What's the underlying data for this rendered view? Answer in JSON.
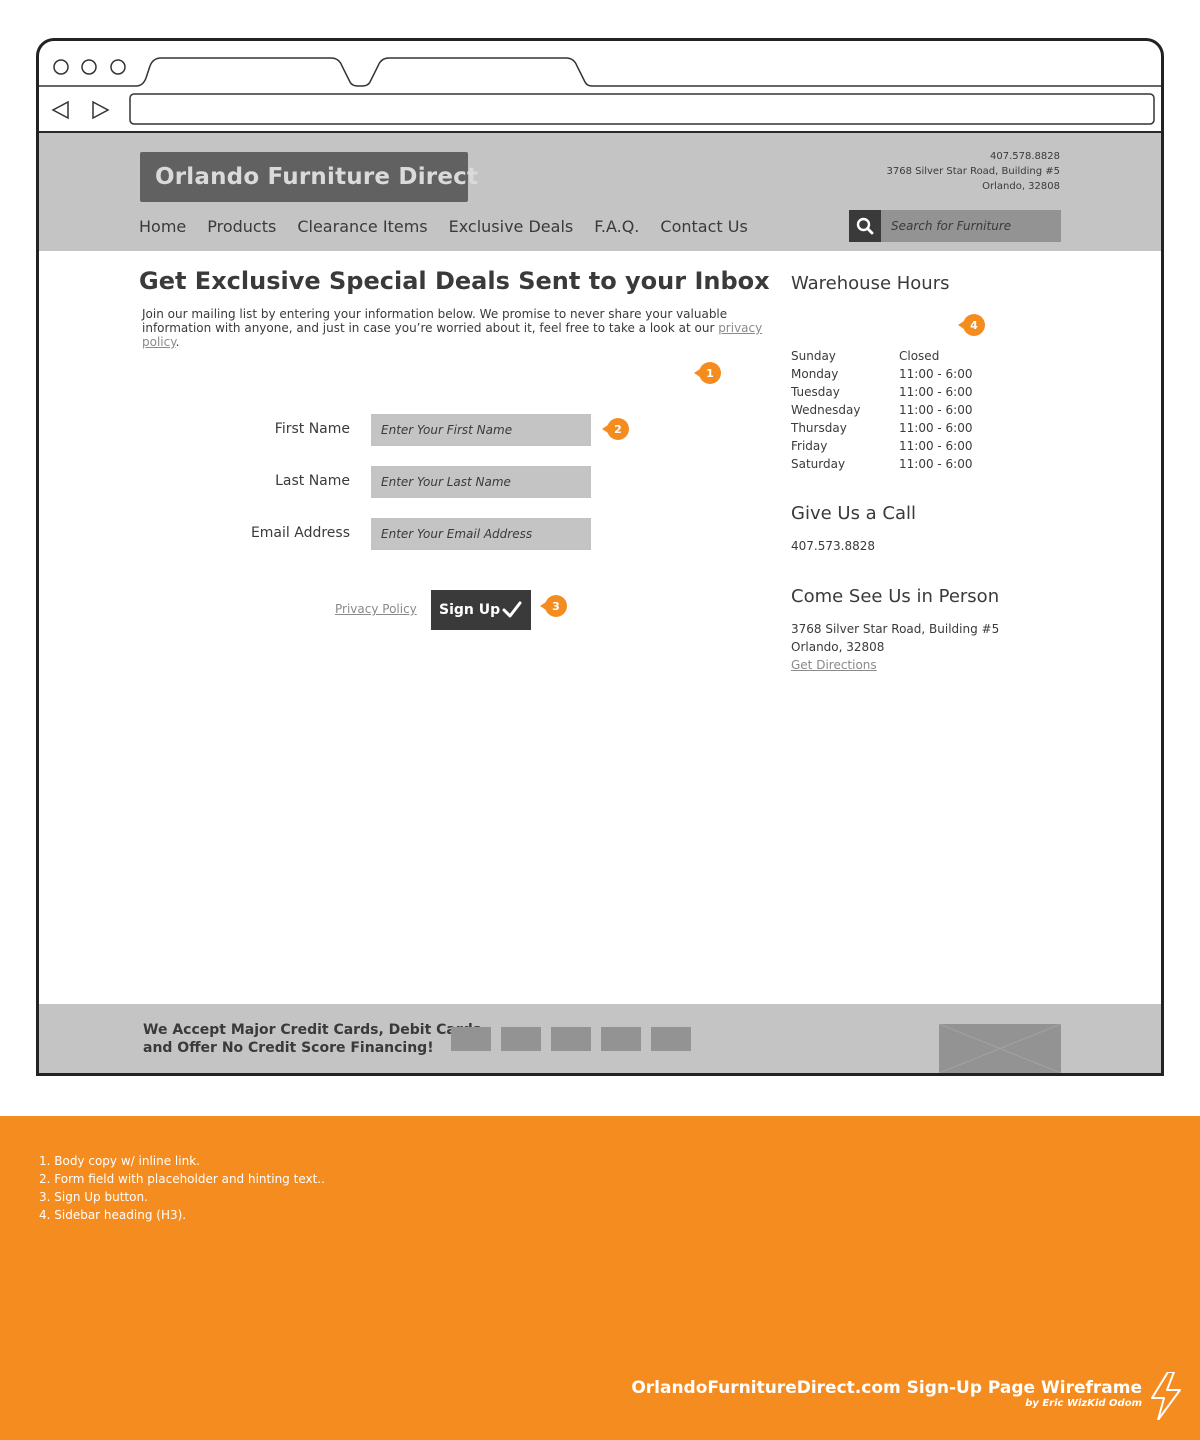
{
  "header": {
    "logo": "Orlando Furniture Direct",
    "phone": "407.578.8828",
    "address_line1": "3768 Silver Star Road, Building #5",
    "address_line2": "Orlando, 32808",
    "nav": [
      "Home",
      "Products",
      "Clearance Items",
      "Exclusive Deals",
      "F.A.Q.",
      "Contact Us"
    ],
    "search_placeholder": "Search for Furniture"
  },
  "main": {
    "title": "Get Exclusive Special Deals Sent to your Inbox",
    "intro_text": "Join our mailing list by entering your information below. We promise to never share your valuable information with anyone, and just in case you’re worried about it, feel free to take a look at our ",
    "intro_link": "privacy policy",
    "intro_end": ".",
    "form": {
      "first_name_label": "First Name",
      "first_name_placeholder": "Enter Your First Name",
      "last_name_label": "Last Name",
      "last_name_placeholder": "Enter Your Last Name",
      "email_label": "Email Address",
      "email_placeholder": "Enter Your Email Address",
      "privacy_link": "Privacy Policy",
      "signup_label": "Sign Up"
    }
  },
  "sidebar": {
    "hours_heading": "Warehouse Hours",
    "hours": [
      {
        "day": "Sunday",
        "time": "Closed"
      },
      {
        "day": "Monday",
        "time": "11:00 - 6:00"
      },
      {
        "day": "Tuesday",
        "time": "11:00 - 6:00"
      },
      {
        "day": "Wednesday",
        "time": "11:00 - 6:00"
      },
      {
        "day": "Thursday",
        "time": "11:00 - 6:00"
      },
      {
        "day": "Friday",
        "time": "11:00 - 6:00"
      },
      {
        "day": "Saturday",
        "time": "11:00 - 6:00"
      }
    ],
    "call_heading": "Give Us a Call",
    "call_phone": "407.573.8828",
    "visit_heading": "Come See Us in Person",
    "visit_line1": "3768 Silver Star Road, Building #5",
    "visit_line2": "Orlando, 32808",
    "directions_link": "Get Directions"
  },
  "callouts": [
    "1",
    "2",
    "3",
    "4"
  ],
  "footer": {
    "text_line1": "We Accept Major Credit Cards, Debit Cards",
    "text_line2": "and Offer No Credit Score Financing!"
  },
  "notes": [
    "1. Body copy w/ inline link.",
    "2. Form field with placeholder and hinting text..",
    "3. Sign Up button.",
    "4. Sidebar heading (H3)."
  ],
  "credit": {
    "title": "OrlandoFurnitureDirect.com Sign-Up Page Wireframe",
    "by": "by Eric WizKid Odom"
  },
  "colors": {
    "accent": "#f58c20",
    "header_bg": "#c4c4c4",
    "dark": "#3a3a3a"
  }
}
